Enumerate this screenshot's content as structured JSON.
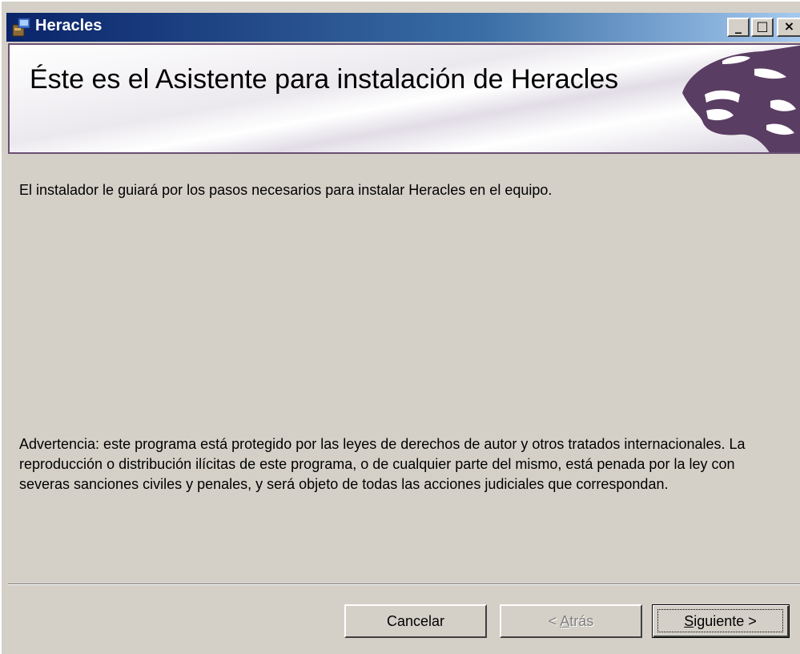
{
  "window": {
    "title": "Heracles",
    "controls": {
      "minimize": "_",
      "maximize": "□",
      "close": "×"
    }
  },
  "banner": {
    "title": "Éste es el Asistente para instalación de Heracles",
    "logo_icon": "heracles-logo"
  },
  "body": {
    "intro": "El instalador le guiará por los pasos necesarios para instalar Heracles en el equipo.",
    "warning": "Advertencia: este programa está protegido por las leyes de derechos de autor y otros tratados internacionales. La reproducción o distribución ilícitas de este programa, o de cualquier parte del mismo, está penada por la ley con severas sanciones civiles y penales, y será objeto de todas las acciones judiciales que correspondan."
  },
  "buttons": {
    "cancel": "Cancelar",
    "back_prefix": "< ",
    "back_accel": "A",
    "back_rest": "trás",
    "next_accel": "S",
    "next_rest": "iguiente >"
  },
  "colors": {
    "face": "#d4d0c8",
    "title_gradient_start": "#0a246a",
    "banner_border": "#6b4f73",
    "logo": "#5a3d63"
  }
}
